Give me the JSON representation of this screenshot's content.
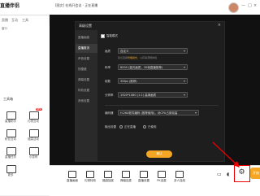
{
  "app": {
    "logo": "直播伴侣",
    "stream_title": "[图文] 在线开会议 · 正在直播"
  },
  "top_tabs": [
    "直播",
    "互动",
    "工具"
  ],
  "window_controls": {
    "minimize": "—",
    "maximize": "□",
    "close": "×"
  },
  "left_panel": {
    "header": "工具箱",
    "items": [
      {
        "label": "直播助手",
        "badge": ""
      },
      {
        "label": "礼物互动",
        "badge": "NEW"
      },
      {
        "label": "粉丝互动",
        "badge": ""
      },
      {
        "label": "福袋活动",
        "badge": ""
      },
      {
        "label": "直播任务",
        "badge": ""
      },
      {
        "label": "小游戏",
        "badge": ""
      },
      {
        "label": "更多",
        "badge": ""
      }
    ],
    "side_label": "窗口"
  },
  "settings_dialog": {
    "title": "高级设置",
    "close": "×",
    "nav": [
      "直播画面",
      "直播推流",
      "声音设置",
      "快捷键",
      "弹幕设置",
      "特效设置",
      "其他设置"
    ],
    "active_index": 1,
    "smart_mode_label": "智能模式",
    "rows": [
      {
        "label": "画质",
        "value": "自定义"
      },
      {
        "label": "码率",
        "value": "8000 (蓝光画质，30帧直播推荐)"
      },
      {
        "label": "帧数",
        "value": "30fps (推荐)"
      },
      {
        "label": "分辨率",
        "value": "1920*1080 (1:1) 高清画质"
      },
      {
        "label": "编码器",
        "value": "H.264软件编码 (推荐使用)，对CPU占用较高"
      }
    ],
    "hint_prefix": "建议选择",
    "hint_link": "智能模式",
    "hint_suffix": "，以获得流畅体验",
    "output_label": "输出设置",
    "output_options": [
      "正在直播",
      "已使用"
    ],
    "confirm_label": "确认"
  },
  "bottom_bar": {
    "items": [
      "直播画面",
      "礼物特效",
      "福袋抽奖",
      "弹幕连麦",
      "直播设置",
      "PK连麦",
      "多人连线"
    ],
    "start_label": "开始"
  },
  "colors": {
    "accent": "#f5a623",
    "highlight": "#e00000",
    "dialog_bg": "#1e1e1e"
  }
}
